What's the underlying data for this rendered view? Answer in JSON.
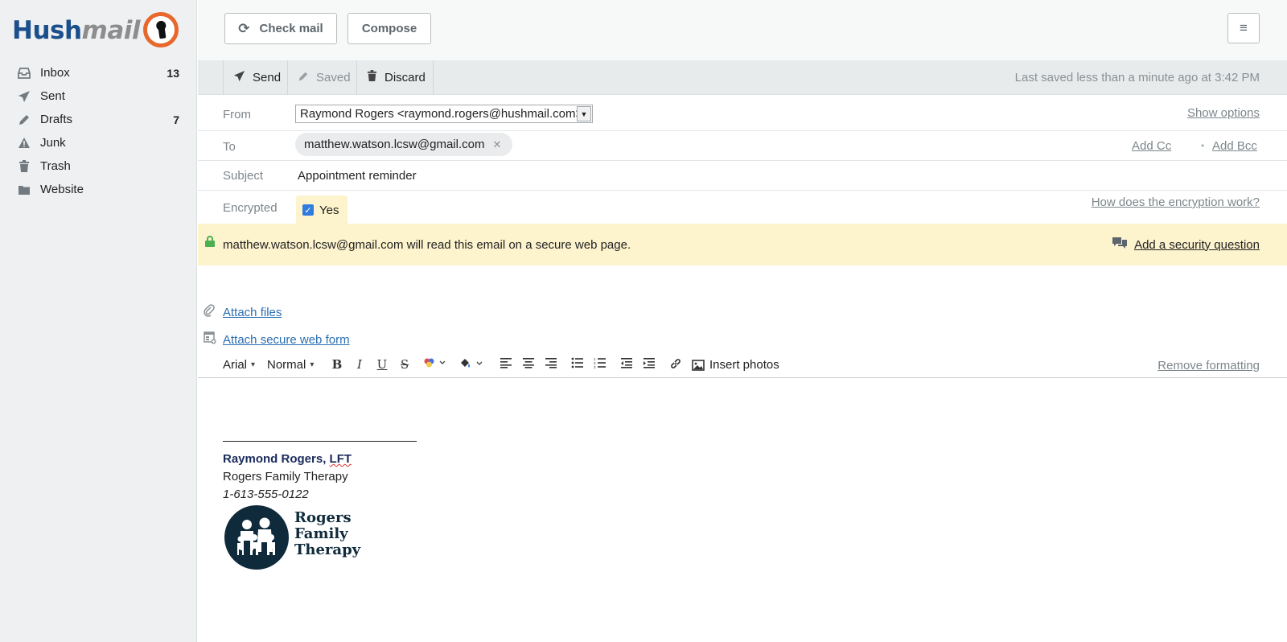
{
  "app": {
    "logo_text_1": "Hush",
    "logo_text_2": "mail"
  },
  "sidebar": {
    "items": [
      {
        "label": "Inbox",
        "count": "13",
        "icon": "inbox-icon"
      },
      {
        "label": "Sent",
        "count": "",
        "icon": "paper-plane-icon"
      },
      {
        "label": "Drafts",
        "count": "7",
        "icon": "pencil-icon"
      },
      {
        "label": "Junk",
        "count": "",
        "icon": "warning-icon"
      },
      {
        "label": "Trash",
        "count": "",
        "icon": "trash-icon"
      },
      {
        "label": "Website",
        "count": "",
        "icon": "folder-icon"
      }
    ]
  },
  "topbar": {
    "check_mail": "Check mail",
    "compose": "Compose"
  },
  "actions": {
    "send": "Send",
    "saved": "Saved",
    "discard": "Discard",
    "last_saved": "Last saved less than a minute ago at 3:42 PM"
  },
  "compose": {
    "from_label": "From",
    "from_value": "Raymond Rogers <raymond.rogers@hushmail.com>",
    "show_options": "Show options",
    "to_label": "To",
    "to_recipient": "matthew.watson.lcsw@gmail.com",
    "add_cc": "Add Cc",
    "add_bcc": "Add Bcc",
    "subject_label": "Subject",
    "subject_value": "Appointment reminder",
    "encrypted_label": "Encrypted",
    "encrypted_value": "Yes",
    "encryption_help": "How does the encryption work?",
    "secure_notice": "matthew.watson.lcsw@gmail.com will read this email on a secure web page.",
    "add_security_question": "Add a security question",
    "attach_files": "Attach files",
    "attach_form": "Attach secure web form"
  },
  "editor": {
    "font": "Arial",
    "size": "Normal",
    "insert_photos": "Insert photos",
    "remove_formatting": "Remove formatting"
  },
  "signature": {
    "name": "Raymond Rogers, ",
    "credential": "LFT",
    "company": "Rogers Family Therapy",
    "phone": "1-613-555-0122",
    "logo_line1": "Rogers",
    "logo_line2": "Family",
    "logo_line3": "Therapy"
  },
  "colors": {
    "brand_blue": "#1b4f8c",
    "brand_orange": "#e8672c",
    "notice_bg": "#fdf3cd",
    "link": "#2b6fb3"
  }
}
